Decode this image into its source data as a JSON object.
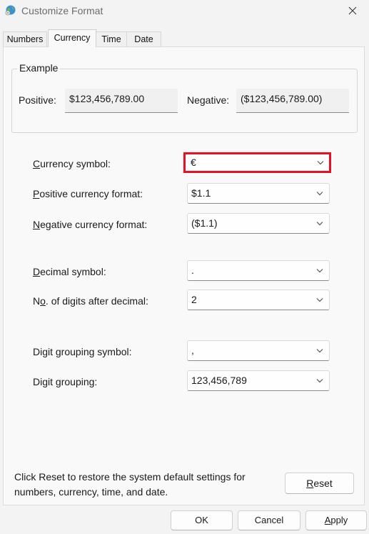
{
  "window": {
    "title": "Customize Format"
  },
  "tabs": [
    {
      "label": "Numbers"
    },
    {
      "label": "Currency"
    },
    {
      "label": "Time"
    },
    {
      "label": "Date"
    }
  ],
  "example": {
    "legend": "Example",
    "positive_label": "Positive:",
    "positive_value": "$123,456,789.00",
    "negative_label": "Negative:",
    "negative_value": "($123,456,789.00)"
  },
  "fields": {
    "currency_symbol": {
      "label_first": "C",
      "label_rest": "urrency symbol:",
      "value": "€"
    },
    "positive_format": {
      "label_first": "P",
      "label_rest": "ositive currency format:",
      "value": "$1.1"
    },
    "negative_format": {
      "label_first": "N",
      "label_rest": "egative currency format:",
      "value": "($1.1)"
    },
    "decimal_symbol": {
      "label_first": "D",
      "label_rest": "ecimal symbol:",
      "value": "."
    },
    "digits_after_decimal": {
      "label_pre": "N",
      "label_ul": "o",
      "label_rest": ". of digits after decimal:",
      "value": "2"
    },
    "grouping_symbol": {
      "label": "Digit grouping symbol:",
      "value": ","
    },
    "digit_grouping": {
      "label_pre": "Di",
      "label_ul": "g",
      "label_rest": "it grouping:",
      "value": "123,456,789"
    }
  },
  "info_text": "Click Reset to restore the system default settings for numbers, currency, time, and date.",
  "buttons": {
    "reset": {
      "label_ul": "R",
      "label_rest": "eset"
    },
    "ok": "OK",
    "cancel": "Cancel",
    "apply": {
      "label_ul": "A",
      "label_rest": "pply"
    }
  },
  "colors": {
    "highlight": "#e81123",
    "panel": "#f9f9f9",
    "background": "#f3f3f3"
  },
  "icons": {
    "app": "globe-settings-icon",
    "close": "close-icon",
    "dropdown": "chevron-down-icon"
  }
}
